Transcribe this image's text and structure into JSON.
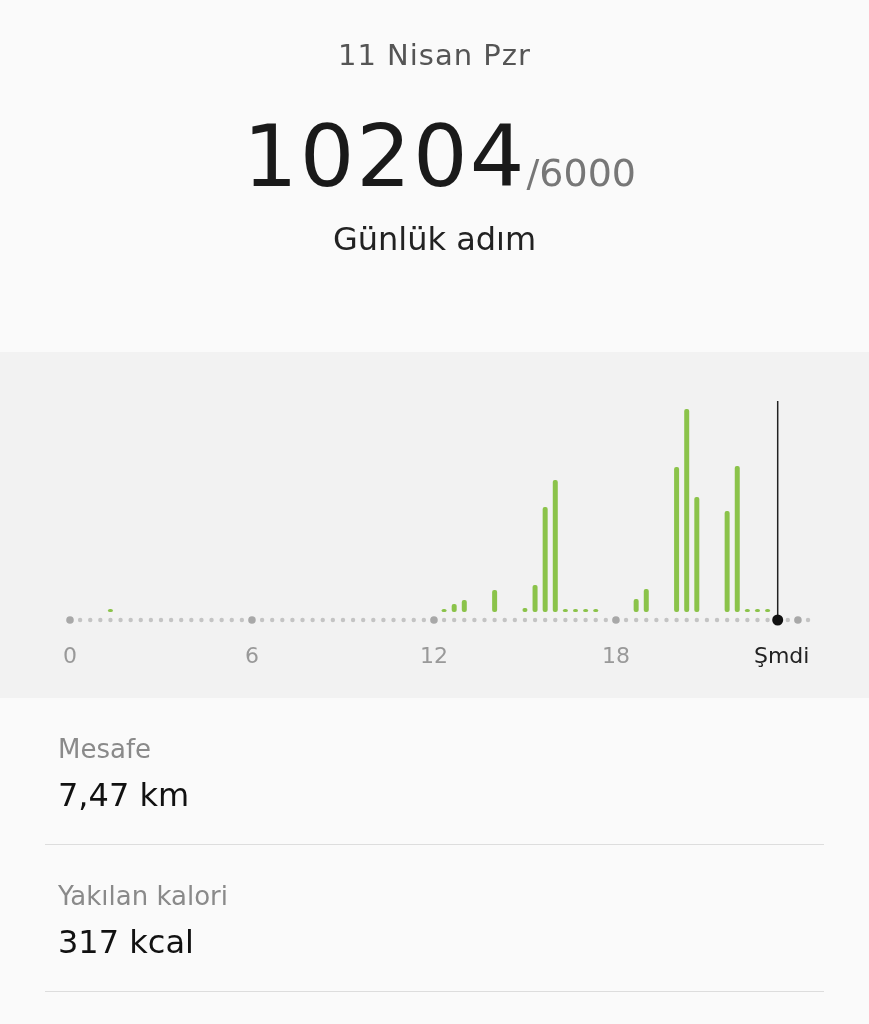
{
  "date": "11 Nisan Pzr",
  "steps": "10204",
  "goal": "/6000",
  "steps_label": "Günlük adım",
  "chart": {
    "x_labels": [
      "0",
      "6",
      "12",
      "18"
    ],
    "now_label": "Şmdi"
  },
  "stats": [
    {
      "label": "Mesafe",
      "value": "7,47 km"
    },
    {
      "label": "Yakılan kalori",
      "value": "317 kcal"
    }
  ]
}
